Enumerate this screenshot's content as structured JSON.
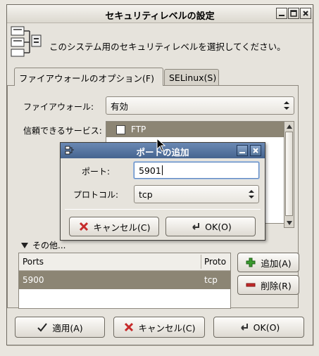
{
  "window": {
    "title": "セキュリティレベルの設定",
    "header_text": "このシステム用のセキュリティレベルを選択してください。"
  },
  "tabs": [
    {
      "label": "ファイアウォールのオプション(F)",
      "active": true
    },
    {
      "label": "SELinux(S)",
      "active": false
    }
  ],
  "firewall": {
    "label": "ファイアウォール:",
    "value": "有効"
  },
  "services": {
    "label": "信頼できるサービス:",
    "items": [
      {
        "label": "FTP",
        "checked": false
      }
    ]
  },
  "other_ports": {
    "label": "その他...",
    "columns": [
      "Ports",
      "Proto"
    ],
    "rows": [
      {
        "port": "5900",
        "proto": "tcp"
      }
    ]
  },
  "side_buttons": {
    "add": "追加(A)",
    "remove": "削除(R)"
  },
  "bottom_buttons": {
    "apply": "適用(A)",
    "cancel": "キャンセル(C)",
    "ok": "OK(O)"
  },
  "dialog": {
    "title": "ポートの追加",
    "port_label": "ポート:",
    "port_value": "5901",
    "protocol_label": "プロトコル:",
    "protocol_value": "tcp",
    "cancel": "キャンセル(C)",
    "ok": "OK(O)"
  },
  "colors": {
    "selection": "#8c8574",
    "dialog_title": "#45648f",
    "add_icon": "#3a9b2e",
    "remove_icon": "#c62a2a"
  }
}
